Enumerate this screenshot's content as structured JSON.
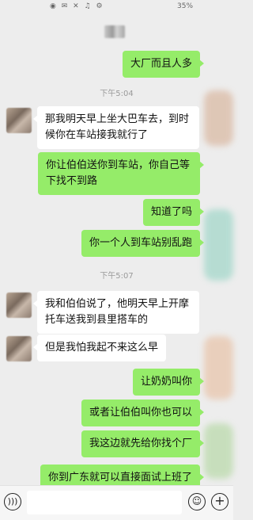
{
  "status_bar": {
    "battery": "35%"
  },
  "messages": [
    {
      "from": "me",
      "text": "大厂而且人多"
    },
    {
      "type": "time",
      "text": "下午5:04"
    },
    {
      "from": "them",
      "text": "那我明天早上坐大巴车去，到时候你在车站接我就行了"
    },
    {
      "from": "me",
      "text": "你让伯伯送你到车站，你自己等下找不到路"
    },
    {
      "from": "me",
      "text": "知道了吗"
    },
    {
      "from": "me",
      "text": "你一个人到车站别乱跑"
    },
    {
      "type": "time",
      "text": "下午5:07"
    },
    {
      "from": "them",
      "text": "我和伯伯说了，他明天早上开摩托车送我到县里搭车的"
    },
    {
      "from": "them",
      "text": "但是我怕我起不来这么早"
    },
    {
      "from": "me",
      "text": "让奶奶叫你"
    },
    {
      "from": "me",
      "text": "或者让伯伯叫你也可以"
    },
    {
      "from": "me",
      "text": "我这边就先给你找个厂"
    },
    {
      "from": "me",
      "text": "你到广东就可以直接面试上班了"
    }
  ],
  "input_bar": {
    "icons": [
      "voice-icon",
      "emoji-icon",
      "plus-icon"
    ]
  },
  "colors": {
    "my_bubble": "#95ec69",
    "their_bubble": "#ffffff",
    "background": "#ededed"
  }
}
